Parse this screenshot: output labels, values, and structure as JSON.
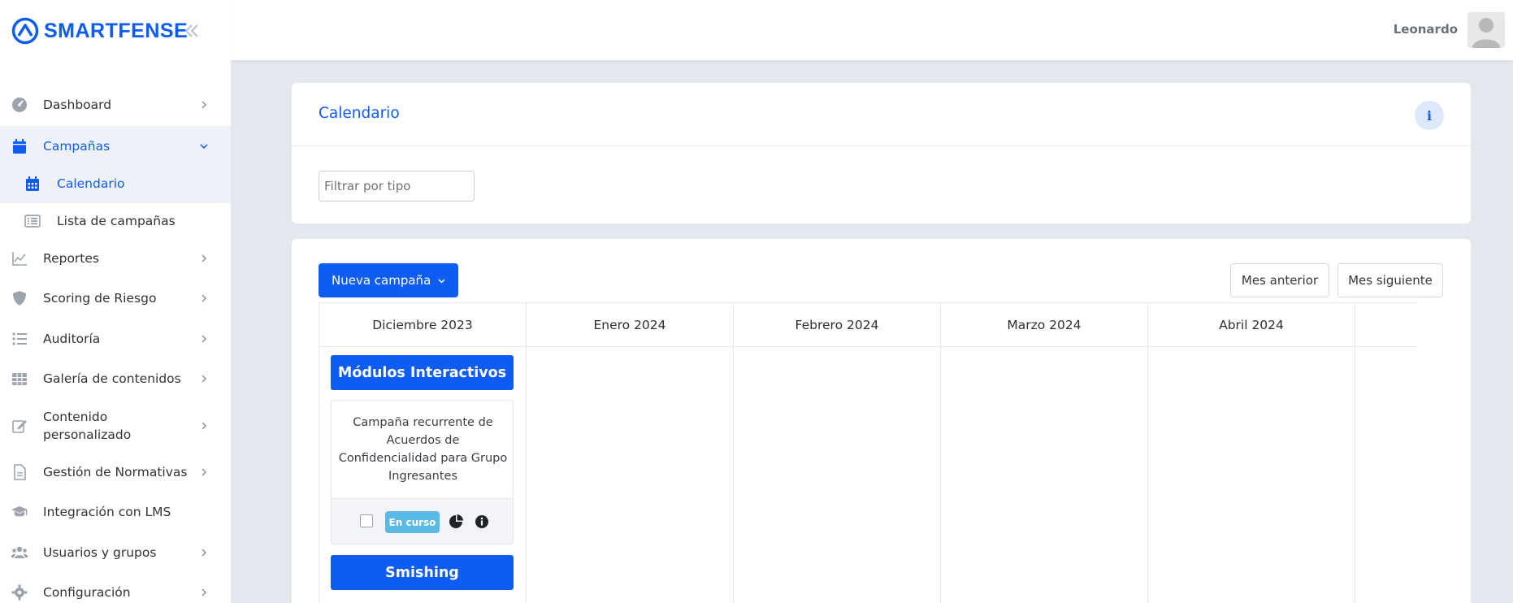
{
  "brand": {
    "name": "SMARTFENSE"
  },
  "colors": {
    "accent": "#0f5cf2",
    "badge": "#5ab9e5"
  },
  "header": {
    "user_name": "Leonardo"
  },
  "sidebar": {
    "items": [
      {
        "label": "Dashboard",
        "icon": "gauge-icon"
      },
      {
        "label": "Campañas",
        "icon": "calendar-icon"
      },
      {
        "label": "Reportes",
        "icon": "chart-line-icon"
      },
      {
        "label": "Scoring de Riesgo",
        "icon": "shield-icon"
      },
      {
        "label": "Auditoría",
        "icon": "list-icon"
      },
      {
        "label": "Galería de contenidos",
        "icon": "grid-icon"
      },
      {
        "label": "Contenido personalizado",
        "icon": "edit-icon"
      },
      {
        "label": "Gestión de Normativas",
        "icon": "document-icon"
      },
      {
        "label": "Integración con LMS",
        "icon": "graduation-cap-icon"
      },
      {
        "label": "Usuarios y grupos",
        "icon": "users-icon"
      },
      {
        "label": "Configuración",
        "icon": "gear-icon"
      }
    ],
    "subitems": [
      {
        "label": "Calendario",
        "icon": "calendar-icon"
      },
      {
        "label": "Lista de campañas",
        "icon": "list-alt-icon"
      }
    ]
  },
  "calendar": {
    "title": "Calendario",
    "info_label": "i",
    "filter_placeholder": "Filtrar por tipo",
    "new_campaign_label": "Nueva campaña",
    "prev_label": "Mes anterior",
    "next_label": "Mes siguiente",
    "months": [
      "Diciembre 2023",
      "Enero 2024",
      "Febrero 2024",
      "Marzo 2024",
      "Abril 2024"
    ],
    "campaigns": [
      {
        "type": "Módulos Interactivos",
        "description": "Campaña recurrente de Acuerdos de Confidencialidad para Grupo Ingresantes",
        "status": "En curso"
      },
      {
        "type": "Smishing"
      }
    ]
  }
}
